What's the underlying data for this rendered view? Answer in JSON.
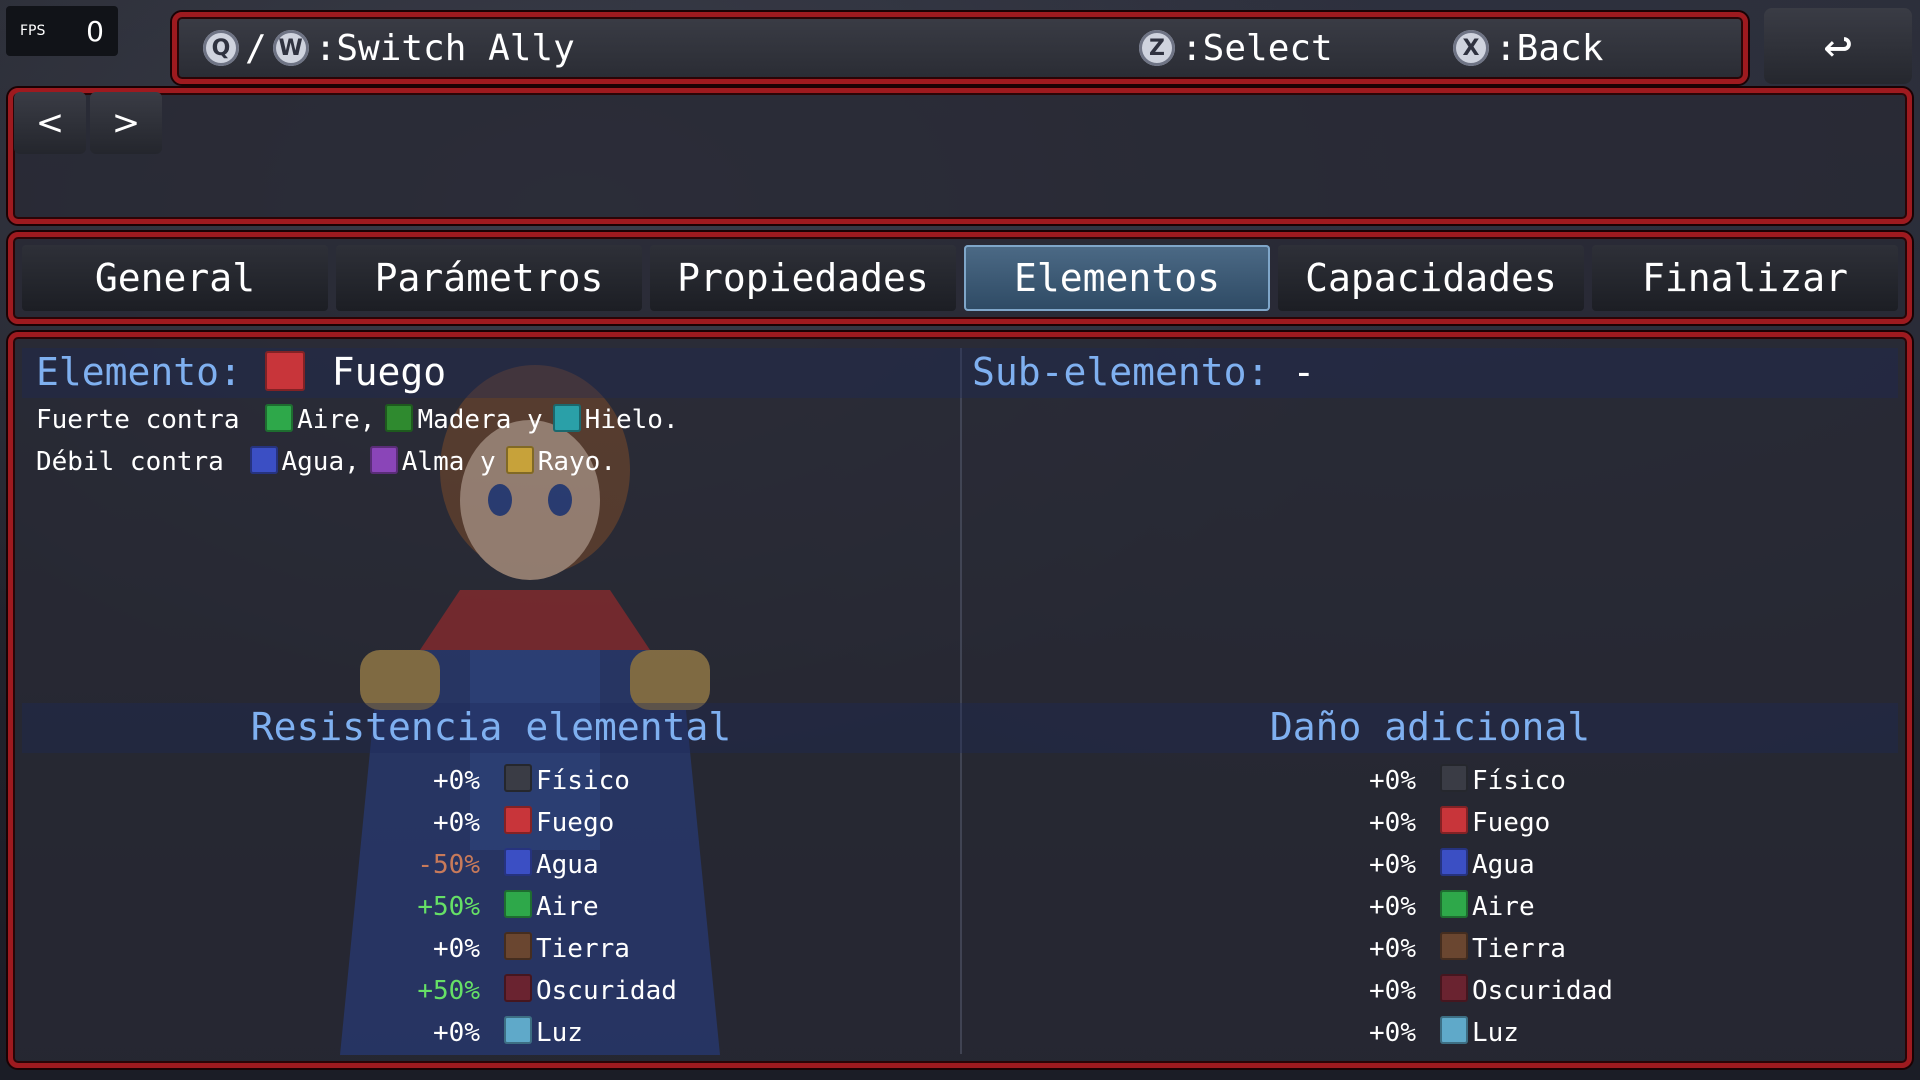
{
  "fps": {
    "label": "FPS",
    "value": "0"
  },
  "help": {
    "switch_keys": [
      "Q",
      "W"
    ],
    "switch_sep": "/",
    "switch_label": ":Switch Ally",
    "select_key": "Z",
    "select_label": ":Select",
    "back_key": "X",
    "back_label": ":Back"
  },
  "back_icon": "↩",
  "nav": {
    "prev": "<",
    "next": ">"
  },
  "tabs": [
    "General",
    "Parámetros",
    "Propiedades",
    "Elementos",
    "Capacidades",
    "Finalizar"
  ],
  "active_tab": 3,
  "element": {
    "label": "Elemento:",
    "value": "Fuego",
    "strong_prefix": "Fuerte contra",
    "strong": [
      {
        "name": "Aire",
        "sep": ","
      },
      {
        "name": "Madera",
        "sep": " y"
      },
      {
        "name": "Hielo",
        "sep": "."
      }
    ],
    "weak_prefix": "Débil contra",
    "weak": [
      {
        "name": "Agua",
        "sep": ","
      },
      {
        "name": "Alma",
        "sep": " y"
      },
      {
        "name": "Rayo",
        "sep": "."
      }
    ]
  },
  "sub_element": {
    "label": "Sub-elemento:",
    "value": "-"
  },
  "resistance": {
    "title": "Resistencia elemental",
    "rows": [
      {
        "value": "+0%",
        "name": "Físico",
        "tone": "zero"
      },
      {
        "value": "+0%",
        "name": "Fuego",
        "tone": "zero"
      },
      {
        "value": "-50%",
        "name": "Agua",
        "tone": "neg"
      },
      {
        "value": "+50%",
        "name": "Aire",
        "tone": "pos"
      },
      {
        "value": "+0%",
        "name": "Tierra",
        "tone": "zero"
      },
      {
        "value": "+50%",
        "name": "Oscuridad",
        "tone": "pos"
      },
      {
        "value": "+0%",
        "name": "Luz",
        "tone": "zero"
      }
    ]
  },
  "damage": {
    "title": "Daño adicional",
    "rows": [
      {
        "value": "+0%",
        "name": "Físico",
        "tone": "zero"
      },
      {
        "value": "+0%",
        "name": "Fuego",
        "tone": "zero"
      },
      {
        "value": "+0%",
        "name": "Agua",
        "tone": "zero"
      },
      {
        "value": "+0%",
        "name": "Aire",
        "tone": "zero"
      },
      {
        "value": "+0%",
        "name": "Tierra",
        "tone": "zero"
      },
      {
        "value": "+0%",
        "name": "Oscuridad",
        "tone": "zero"
      },
      {
        "value": "+0%",
        "name": "Luz",
        "tone": "zero"
      }
    ]
  },
  "icon_colors": {
    "Físico": "#3a3c45",
    "Fuego": "#c8353a",
    "Agua": "#3b4fc4",
    "Aire": "#2ea84a",
    "Tierra": "#6a4630",
    "Oscuridad": "#6a2330",
    "Luz": "#5fa9c9",
    "Madera": "#2f8a2f",
    "Hielo": "#2aa0a8",
    "Alma": "#8a45b8",
    "Rayo": "#c7a23a"
  }
}
